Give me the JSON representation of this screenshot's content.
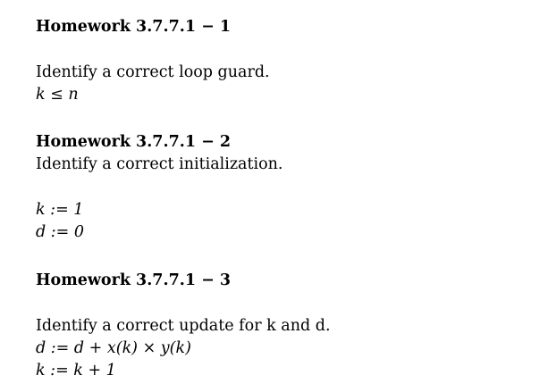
{
  "homeworks": [
    {
      "title": "Homework 3.7.7.1 − 1",
      "prompt": "Identify a correct loop guard.",
      "answer_lines": [
        "k ≤ n"
      ]
    },
    {
      "title": "Homework 3.7.7.1 − 2",
      "prompt": "Identify a correct initialization.",
      "answer_lines": [
        "k := 1",
        "d := 0"
      ]
    },
    {
      "title": "Homework 3.7.7.1 − 3",
      "prompt": "Identify a correct update for k and d.",
      "answer_lines": [
        "d := d + x(k) × y(k)",
        "k := k + 1"
      ]
    }
  ]
}
